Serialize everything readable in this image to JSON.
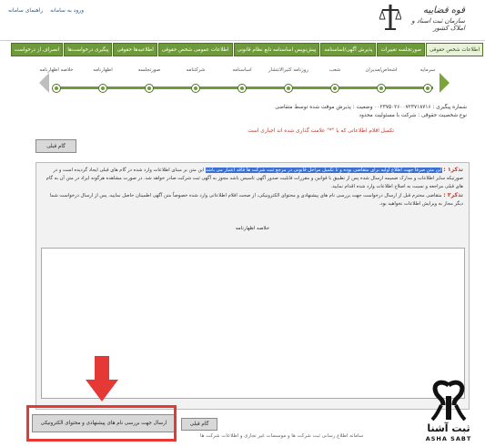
{
  "header": {
    "top_links": [
      "ورود به سامانه",
      "راهنمای سامانه"
    ],
    "logo_line1": "قوه قضاییه",
    "logo_line2": "سازمان ثبت اسناد و املاک کشور"
  },
  "nav": {
    "items": [
      "اطلاعات شخص حقوقی",
      "صورتجلسه تغییرات",
      "پذیرش آگهی/اساسنامه",
      "پیش‌نویس اساسنامه تابع نظام قانونی",
      "اطلاعات عمومی شخص حقوقی",
      "اطلاعیه‌ها حقوقی",
      "پیگیری درخواست‌ها",
      "انصراف از درخواست"
    ],
    "active_index": 0
  },
  "stepper": {
    "steps": [
      "سرمایه",
      "اشخاص/مدیران",
      "شعب",
      "روزنامه کثیرالانتشار",
      "اساسنامه",
      "شرکتنامه",
      "صورتجلسه",
      "اظهارنامه",
      "خلاصه اظهارنامه"
    ],
    "completed_count": 9
  },
  "info": {
    "line1": "شماره پیگیری : ۰۰۲۳۷۵۰۲۶۰۰۷۲۳۷۱۸۷۱۶   وضعیت : پذیرش موقت شده توسط متقاضی",
    "line2": "نوع شخصیت حقوقی : شرکت با مسئولیت محدود",
    "note": "تکمیل اقلام اطلاعاتی که با \"*\" علامت گذاری شده اند اجباری است"
  },
  "buttons": {
    "prev_top": "گام قبلی",
    "prev_bottom": "گام قبلی",
    "send": "ارسال جهت بررسی نام های پیشنهادی و محتوای الکترونیکی"
  },
  "panel": {
    "tag1": "تذکر۱ :",
    "note1_highlight": "این متن صرفاً جهت اطلاع اولیه برای متقاضی بوده و تا تکمیل مراحل قانونی در مرجع ثبت شرکت ها فاقد اعتبار می باشد",
    "note1_rest": "این متن بر مبنای اطلاعات وارد شده در گام های قبلی ایجاد گردیده است و در صورتیکه سایر اطلاعات و مدارک ضمیمه ارسال شده پس از تطبیق با قوانین و مقررات قابلیت صدور آگهی تاسیس باشد مجوز به آگهی ثبت شرکت صادر خواهد شد. در صورت مشاهده هرگونه ایراد در متن آن به گام های قبلی مراجعه و نسبت به اصلاح اطلاعات وارد شده اقدام نمایید.",
    "tag2": "تذکر۲ :",
    "note2": "متقاضی محترم قبل از ارسال درخواست جهت بررسی نام های پیشنهادی و محتوای الکترونیکی، از صحت اقلام اطلاعاتی وارد شده خصوصاً متن آگهی اطمینان حاصل نمایید، پس از ارسال درخواست شما دیگر مجاز به ویرایش اطلاعات نخواهید بود.",
    "textarea_label": "خلاصه اظهارنامه"
  },
  "footer": {
    "text": "سامانه اطلاع رسانی ثبت شرکت ها و موسسات غیر تجاری و اطلاعات شرکت ها"
  },
  "brand": {
    "name": "ثبت آشنا",
    "latin": "ASHA SABT"
  },
  "colors": {
    "nav_green": "#6f9a3a",
    "highlight_red": "#e53935",
    "selection_blue": "#3b6fd0"
  }
}
